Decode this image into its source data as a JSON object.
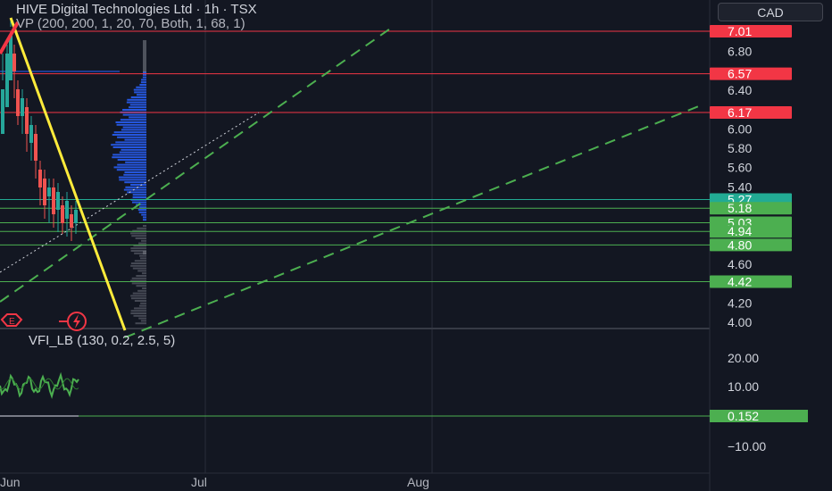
{
  "header": {
    "symbol_title": "HIVE Digital Technologies Ltd · 1h · TSX",
    "vp_indicator": "VP (200, 200, 1, 20, 70, Both, 1, 68, 1)",
    "currency_button": "CAD"
  },
  "lower_pane": {
    "indicator_title": "VFI_LB (130, 0.2, 2.5, 5)"
  },
  "price_axis": {
    "ticks": [
      "6.80",
      "6.40",
      "6.00",
      "5.80",
      "5.60",
      "5.40",
      "4.60",
      "4.20",
      "4.00"
    ]
  },
  "price_tags": [
    {
      "label": "7.01",
      "value": 7.01,
      "color": "#f23645"
    },
    {
      "label": "6.57",
      "value": 6.57,
      "color": "#f23645"
    },
    {
      "label": "6.17",
      "value": 6.17,
      "color": "#f23645"
    },
    {
      "label": "5.27",
      "value": 5.27,
      "color": "#22ab94"
    },
    {
      "label": "5.18",
      "value": 5.18,
      "color": "#4caf50"
    },
    {
      "label": "5.03",
      "value": 5.03,
      "color": "#4caf50"
    },
    {
      "label": "4.94",
      "value": 4.94,
      "color": "#4caf50"
    },
    {
      "label": "4.80",
      "value": 4.8,
      "color": "#4caf50"
    },
    {
      "label": "4.42",
      "value": 4.42,
      "color": "#4caf50"
    }
  ],
  "vfi_axis": {
    "ticks": [
      "20.00",
      "10.00",
      "−10.00"
    ],
    "tag": {
      "label": "0.152",
      "value": 0.152,
      "color": "#4caf50"
    }
  },
  "time_axis": {
    "labels": [
      "Jun",
      "Jul",
      "Aug"
    ]
  },
  "colors": {
    "background": "#131722",
    "grid": "#2a2e39",
    "resistance": "#f23645",
    "support": "#4caf50",
    "trendline": "#ffeb3b",
    "dashed_channel": "#4caf50",
    "volume_profile": "#2962ff"
  },
  "icons": [
    "earnings-icon",
    "dividend-icon"
  ]
}
